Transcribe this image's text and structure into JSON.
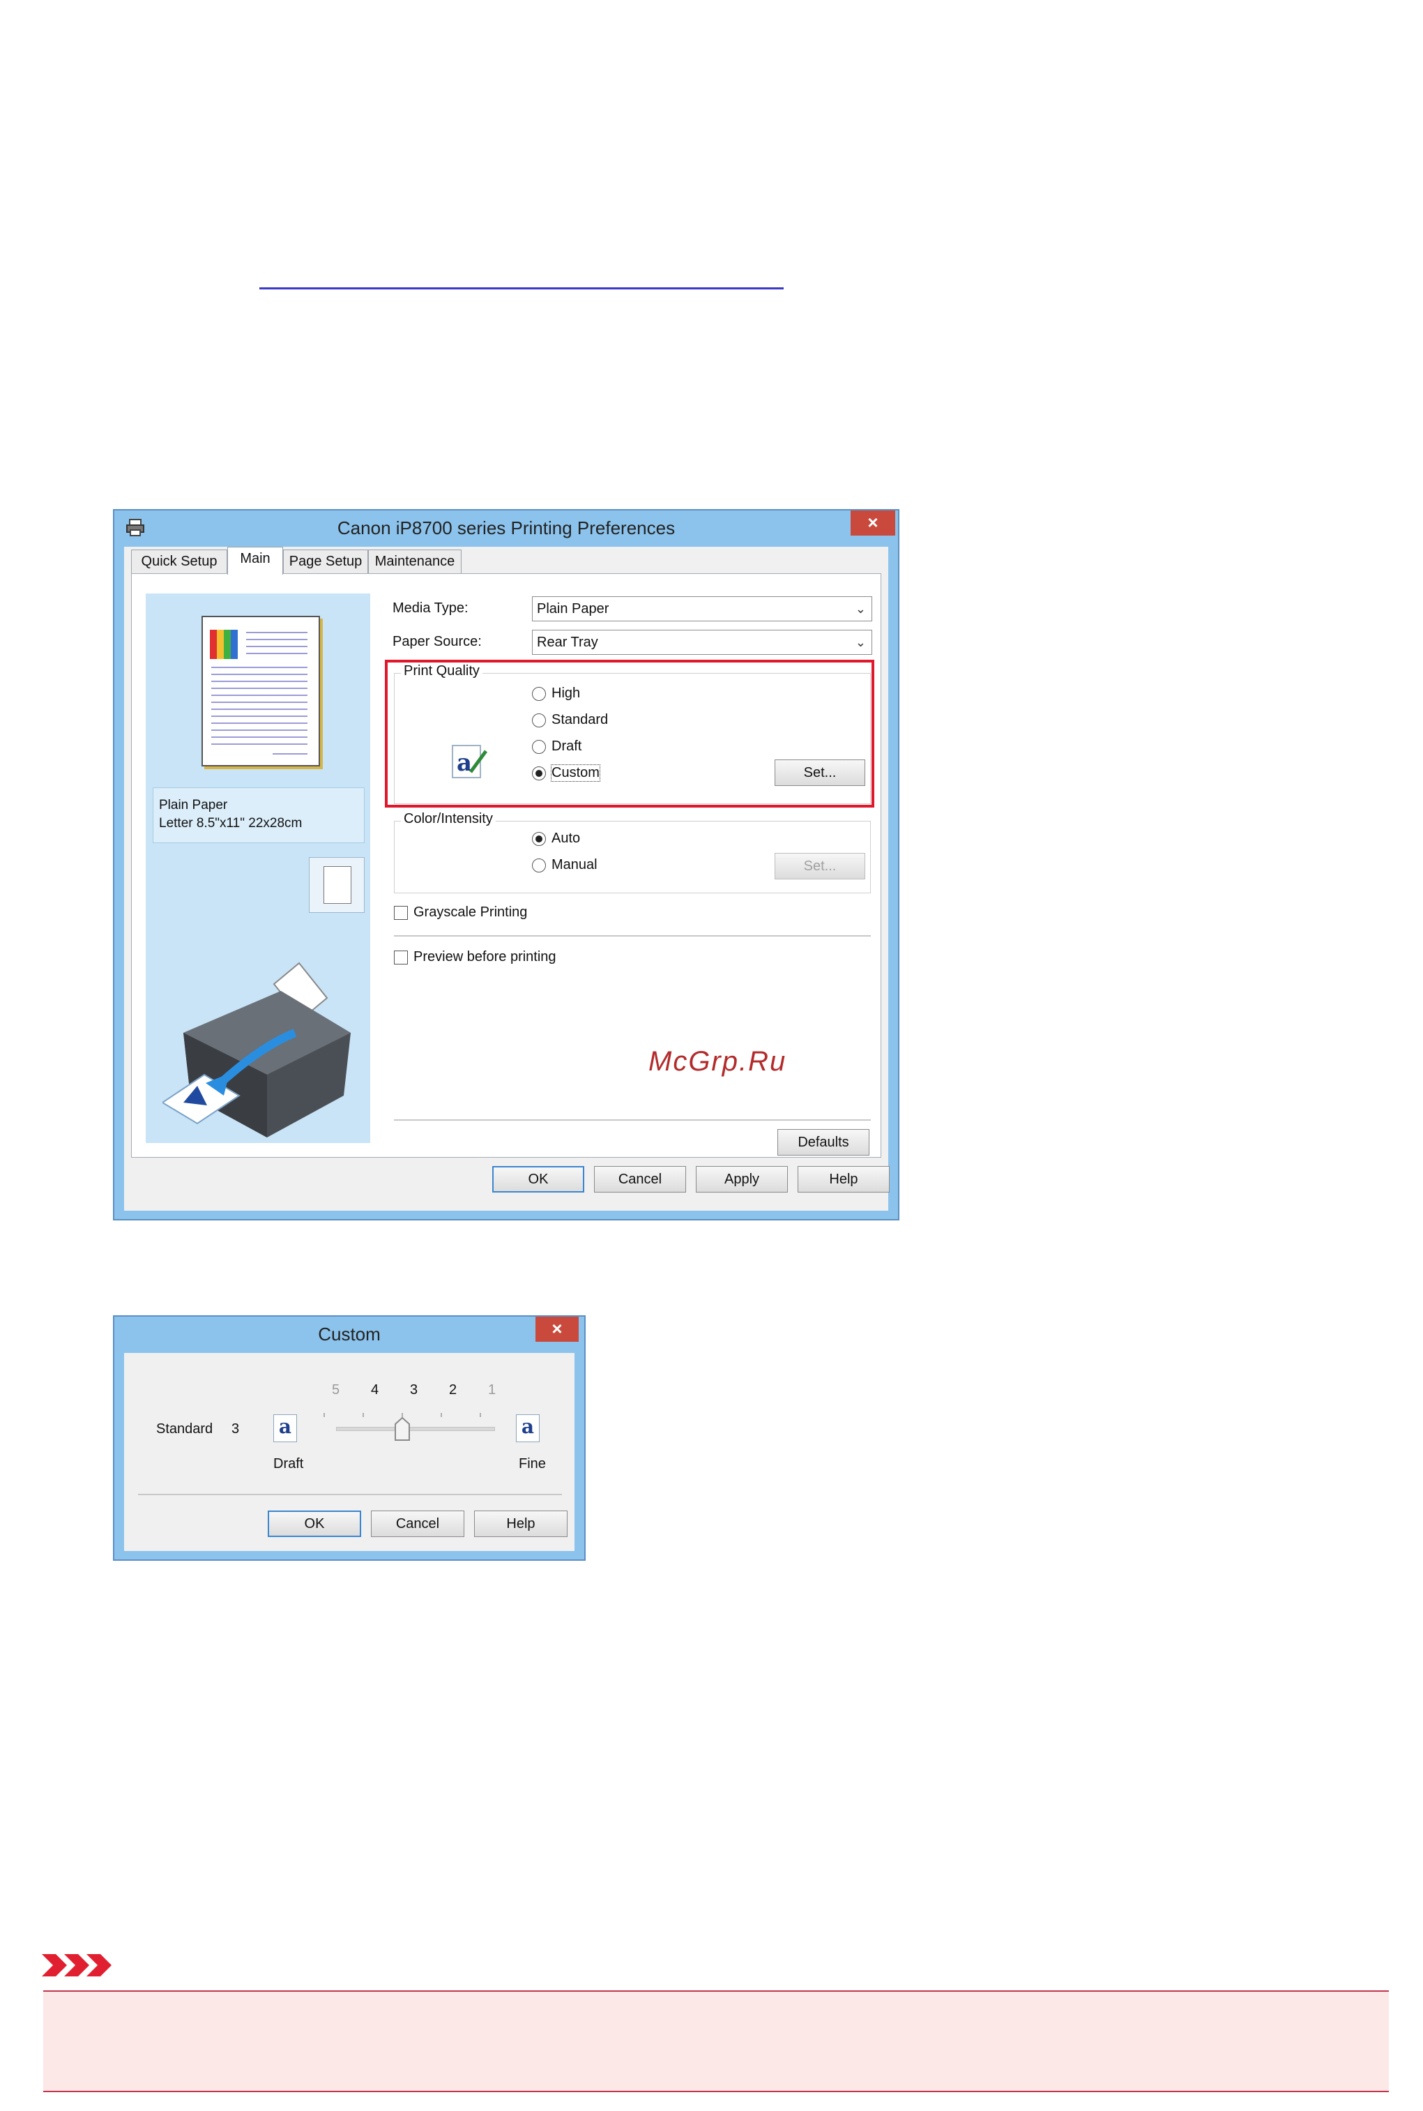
{
  "main_dialog": {
    "title": "Canon iP8700 series Printing Preferences",
    "close_glyph": "×",
    "tabs": [
      {
        "label": "Quick Setup",
        "active": false
      },
      {
        "label": "Main",
        "active": true
      },
      {
        "label": "Page Setup",
        "active": false
      },
      {
        "label": "Maintenance",
        "active": false
      }
    ],
    "preview": {
      "media_line": "Plain Paper",
      "size_line": "Letter 8.5\"x11\" 22x28cm"
    },
    "media_type": {
      "label": "Media Type:",
      "value": "Plain Paper"
    },
    "paper_source": {
      "label": "Paper Source:",
      "value": "Rear Tray"
    },
    "print_quality": {
      "title": "Print Quality",
      "options": [
        "High",
        "Standard",
        "Draft",
        "Custom"
      ],
      "selected": "Custom",
      "set_button": "Set..."
    },
    "color_intensity": {
      "title": "Color/Intensity",
      "options": [
        "Auto",
        "Manual"
      ],
      "selected": "Auto",
      "set_button": "Set..."
    },
    "grayscale_label": "Grayscale Printing",
    "preview_before_label": "Preview before printing",
    "defaults_button": "Defaults",
    "buttons": {
      "ok": "OK",
      "cancel": "Cancel",
      "apply": "Apply",
      "help": "Help"
    },
    "highlight_color": "#e0182c"
  },
  "watermark": "McGrp.Ru",
  "custom_dialog": {
    "title": "Custom",
    "close_glyph": "×",
    "current_label": "Standard",
    "current_value": "3",
    "ticks": [
      "5",
      "4",
      "3",
      "2",
      "1"
    ],
    "slider_value": 3,
    "draft_label": "Draft",
    "fine_label": "Fine",
    "icon_glyph": "a",
    "buttons": {
      "ok": "OK",
      "cancel": "Cancel",
      "help": "Help"
    }
  },
  "note": {
    "icon": "important-chevrons-icon",
    "accent": "#e02030"
  }
}
